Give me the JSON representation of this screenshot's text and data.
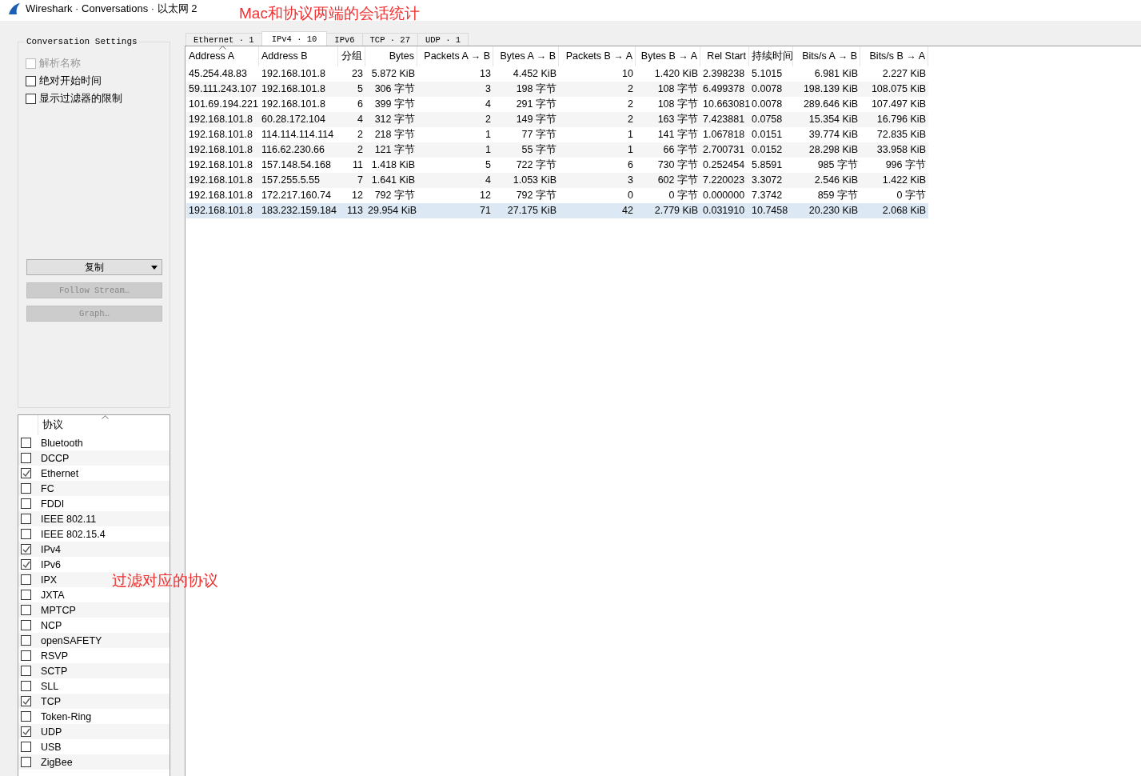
{
  "window": {
    "title": "Wireshark · Conversations · 以太网 2"
  },
  "annotations": [
    {
      "text": "Mac和协议两端的会话统计"
    },
    {
      "text": "过滤对应的协议"
    }
  ],
  "settings": {
    "title": "Conversation Settings",
    "options": [
      {
        "label": "解析名称",
        "checked": false,
        "disabled": true
      },
      {
        "label": "绝对开始时间",
        "checked": false,
        "disabled": false
      },
      {
        "label": "显示过滤器的限制",
        "checked": false,
        "disabled": false
      }
    ]
  },
  "buttons": [
    {
      "label": "复制",
      "kind": "dropdown",
      "disabled": false
    },
    {
      "label": "Follow Stream…",
      "kind": "plain",
      "disabled": true
    },
    {
      "label": "Graph…",
      "kind": "plain",
      "disabled": true
    }
  ],
  "protocol_list": {
    "header": "协议",
    "items": [
      {
        "label": "Bluetooth",
        "checked": false
      },
      {
        "label": "DCCP",
        "checked": false
      },
      {
        "label": "Ethernet",
        "checked": true
      },
      {
        "label": "FC",
        "checked": false
      },
      {
        "label": "FDDI",
        "checked": false
      },
      {
        "label": "IEEE 802.11",
        "checked": false
      },
      {
        "label": "IEEE 802.15.4",
        "checked": false
      },
      {
        "label": "IPv4",
        "checked": true
      },
      {
        "label": "IPv6",
        "checked": true
      },
      {
        "label": "IPX",
        "checked": false
      },
      {
        "label": "JXTA",
        "checked": false
      },
      {
        "label": "MPTCP",
        "checked": false
      },
      {
        "label": "NCP",
        "checked": false
      },
      {
        "label": "openSAFETY",
        "checked": false
      },
      {
        "label": "RSVP",
        "checked": false
      },
      {
        "label": "SCTP",
        "checked": false
      },
      {
        "label": "SLL",
        "checked": false
      },
      {
        "label": "TCP",
        "checked": true
      },
      {
        "label": "Token-Ring",
        "checked": false
      },
      {
        "label": "UDP",
        "checked": true
      },
      {
        "label": "USB",
        "checked": false
      },
      {
        "label": "ZigBee",
        "checked": false
      }
    ]
  },
  "tabs": [
    {
      "label": "Ethernet · 1",
      "selected": false
    },
    {
      "label": "IPv4 · 10",
      "selected": true
    },
    {
      "label": "IPv6",
      "selected": false
    },
    {
      "label": "TCP · 27",
      "selected": false
    },
    {
      "label": "UDP · 1",
      "selected": false
    }
  ],
  "table": {
    "columns": [
      "Address A",
      "Address B",
      "分组",
      "Bytes",
      "Packets A → B",
      "Bytes A → B",
      "Packets B → A",
      "Bytes B → A",
      "Rel Start",
      "持续时间",
      "Bits/s A → B",
      "Bits/s B → A"
    ],
    "rows": [
      {
        "selected": false,
        "cells": [
          "45.254.48.83",
          "192.168.101.8",
          "23",
          "5.872 KiB",
          "13",
          "4.452 KiB",
          "10",
          "1.420 KiB",
          "2.398238",
          "5.1015",
          "6.981 KiB",
          "2.227 KiB"
        ]
      },
      {
        "selected": false,
        "cells": [
          "59.111.243.107",
          "192.168.101.8",
          "5",
          "306 字节",
          "3",
          "198 字节",
          "2",
          "108 字节",
          "6.499378",
          "0.0078",
          "198.139 KiB",
          "108.075 KiB"
        ]
      },
      {
        "selected": false,
        "cells": [
          "101.69.194.221",
          "192.168.101.8",
          "6",
          "399 字节",
          "4",
          "291 字节",
          "2",
          "108 字节",
          "10.663081",
          "0.0078",
          "289.646 KiB",
          "107.497 KiB"
        ]
      },
      {
        "selected": false,
        "cells": [
          "192.168.101.8",
          "60.28.172.104",
          "4",
          "312 字节",
          "2",
          "149 字节",
          "2",
          "163 字节",
          "7.423881",
          "0.0758",
          "15.354 KiB",
          "16.796 KiB"
        ]
      },
      {
        "selected": false,
        "cells": [
          "192.168.101.8",
          "114.114.114.114",
          "2",
          "218 字节",
          "1",
          "77 字节",
          "1",
          "141 字节",
          "1.067818",
          "0.0151",
          "39.774 KiB",
          "72.835 KiB"
        ]
      },
      {
        "selected": false,
        "cells": [
          "192.168.101.8",
          "116.62.230.66",
          "2",
          "121 字节",
          "1",
          "55 字节",
          "1",
          "66 字节",
          "2.700731",
          "0.0152",
          "28.298 KiB",
          "33.958 KiB"
        ]
      },
      {
        "selected": false,
        "cells": [
          "192.168.101.8",
          "157.148.54.168",
          "11",
          "1.418 KiB",
          "5",
          "722 字节",
          "6",
          "730 字节",
          "0.252454",
          "5.8591",
          "985 字节",
          "996 字节"
        ]
      },
      {
        "selected": false,
        "cells": [
          "192.168.101.8",
          "157.255.5.55",
          "7",
          "1.641 KiB",
          "4",
          "1.053 KiB",
          "3",
          "602 字节",
          "7.220023",
          "3.3072",
          "2.546 KiB",
          "1.422 KiB"
        ]
      },
      {
        "selected": false,
        "cells": [
          "192.168.101.8",
          "172.217.160.74",
          "12",
          "792 字节",
          "12",
          "792 字节",
          "0",
          "0 字节",
          "0.000000",
          "7.3742",
          "859 字节",
          "0 字节"
        ]
      },
      {
        "selected": true,
        "cells": [
          "192.168.101.8",
          "183.232.159.184",
          "113",
          "29.954 KiB",
          "71",
          "27.175 KiB",
          "42",
          "2.779 KiB",
          "0.031910",
          "10.7458",
          "20.230 KiB",
          "2.068 KiB"
        ]
      }
    ]
  }
}
